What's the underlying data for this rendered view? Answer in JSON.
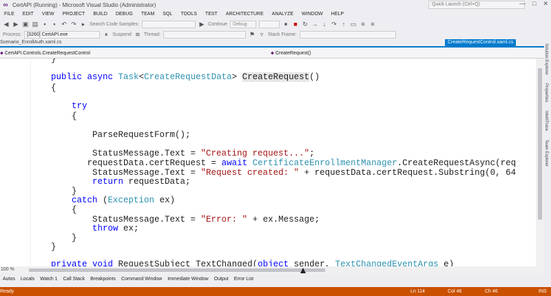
{
  "titlebar": {
    "title": "CertAPI (Running) - Microsoft Visual Studio (Administrator)",
    "quick_launch": "Quick Launch (Ctrl+Q)"
  },
  "menu": [
    "FILE",
    "EDIT",
    "VIEW",
    "PROJECT",
    "BUILD",
    "DEBUG",
    "TEAM",
    "SQL",
    "TOOLS",
    "TEST",
    "ARCHITECTURE",
    "ANALYZE",
    "WINDOW",
    "HELP"
  ],
  "toolbar": {
    "search_code_samples": "Search Code Samples:",
    "continue": "Continue",
    "config": "Debug",
    "process_label": "Process:",
    "process_value": "[3260] CertAPI.exe",
    "suspend": "Suspend",
    "thread_label": "Thread:",
    "stack_frame_label": "Stack Frame:"
  },
  "tabs": {
    "left": "Scenario_EnrollAuth.xaml.cs",
    "active": "CreateRequestControl.xaml.cs"
  },
  "navbar": {
    "left": "CertAPI.Controls.CreateRequestControl",
    "right": "CreateRequest()"
  },
  "side_tabs": [
    "Solution Explorer",
    "Properties",
    "IntelliTrace",
    "Team Explorer"
  ],
  "code_lines": [
    {
      "id": "l0",
      "text": "        }"
    },
    {
      "id": "l1",
      "text": ""
    },
    {
      "id": "l2",
      "text": "        public async Task<CreateRequestData> CreateRequest()"
    },
    {
      "id": "l3",
      "text": "        {"
    },
    {
      "id": "l4",
      "text": "            try"
    },
    {
      "id": "l5",
      "text": "            {"
    },
    {
      "id": "l6",
      "text": "                ParseRequestForm();"
    },
    {
      "id": "l7",
      "text": "                StatusMessage.Text = \"Creating request...\";"
    },
    {
      "id": "l8",
      "text": "               requestData.certRequest = await CertificateEnrollmentManager.CreateRequestAsync(req"
    },
    {
      "id": "l9",
      "text": "                StatusMessage.Text = \"Request created: \" + requestData.certRequest.Substring(0, 64"
    },
    {
      "id": "l10",
      "text": "                return requestData;"
    },
    {
      "id": "l11",
      "text": "            }"
    },
    {
      "id": "l12",
      "text": "            catch (Exception ex)"
    },
    {
      "id": "l13",
      "text": "            {"
    },
    {
      "id": "l14",
      "text": "                StatusMessage.Text = \"Error: \" + ex.Message;"
    },
    {
      "id": "l15",
      "text": "                throw ex;"
    },
    {
      "id": "l16",
      "text": "            }"
    },
    {
      "id": "l17",
      "text": "        }"
    },
    {
      "id": "l18",
      "text": "        private void RequestSubject_TextChanged(object sender, TextChangedEventArgs e)"
    }
  ],
  "zoom": "100 %",
  "bottom_tabs": [
    "Autos",
    "Locals",
    "Watch 1",
    "Call Stack",
    "Breakpoints",
    "Command Window",
    "Immediate Window",
    "Output",
    "Error List"
  ],
  "status": {
    "ready": "Ready",
    "line": "Ln 114",
    "col": "Col 46",
    "ch": "Ch 46",
    "mode": "INS"
  },
  "colors": {
    "accent": "#007acc",
    "status_bar": "#ca5100",
    "keyword": "#0000ff",
    "type": "#2b91af",
    "string": "#a31515"
  }
}
